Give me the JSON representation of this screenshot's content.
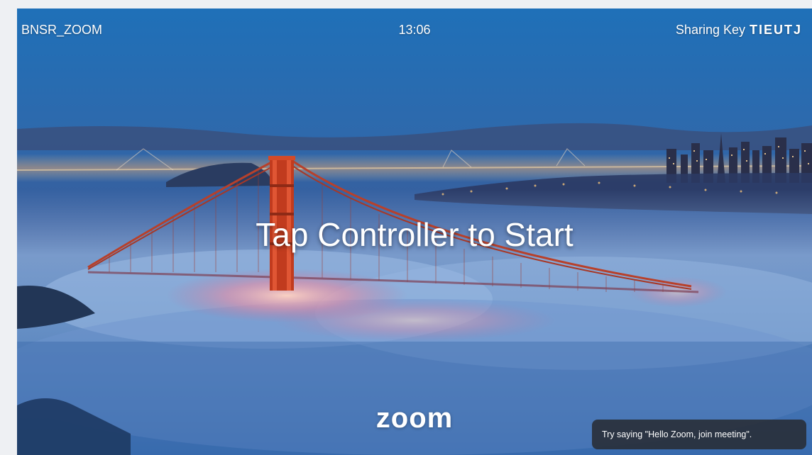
{
  "header": {
    "room_name": "BNSR_ZOOM",
    "clock": "13:06",
    "sharing_label": "Sharing Key",
    "sharing_key": "TIEUTJ"
  },
  "main": {
    "prompt": "Tap Controller to Start"
  },
  "footer": {
    "logo": "zoom",
    "voice_hint": "Try saying \"Hello Zoom, join meeting\"."
  },
  "colors": {
    "sky_top": "#246fb6",
    "sky_mid": "#2f5fa5",
    "fog": "#8eb0d8",
    "bridge": "#c13b1e",
    "city_lights": "#ffb36b"
  }
}
